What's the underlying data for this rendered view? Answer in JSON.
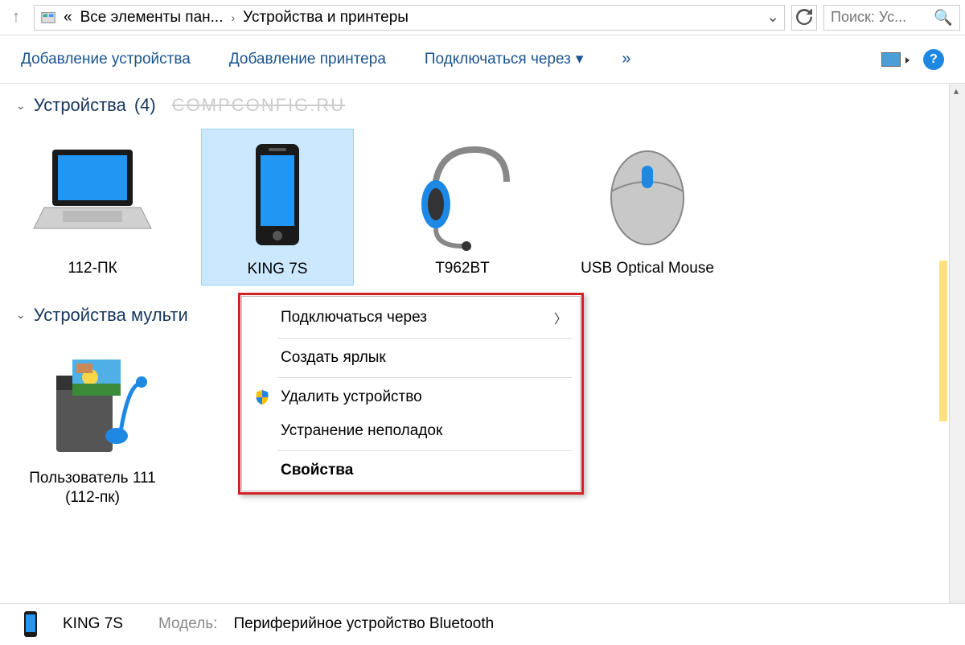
{
  "breadcrumb": {
    "prefix": "«",
    "item1": "Все элементы пан...",
    "sep": "›",
    "item2": "Устройства и принтеры"
  },
  "search": {
    "placeholder": "Поиск: Ус..."
  },
  "toolbar": {
    "add_device": "Добавление устройства",
    "add_printer": "Добавление принтера",
    "connect_via": "Подключаться через",
    "more": "»"
  },
  "sections": {
    "devices": {
      "title": "Устройства",
      "count": "(4)"
    },
    "multimedia": {
      "title": "Устройства мульти"
    }
  },
  "watermark": "COMPCONFIG.RU",
  "devices": [
    {
      "name": "112-ПК",
      "icon": "laptop"
    },
    {
      "name": "KING 7S",
      "icon": "phone",
      "selected": true
    },
    {
      "name": "T962BT",
      "icon": "headset"
    },
    {
      "name": "USB Optical Mouse",
      "icon": "mouse"
    }
  ],
  "multimedia_devices": [
    {
      "name": "Пользователь 111 (112-пк)",
      "icon": "media"
    }
  ],
  "context_menu": {
    "connect": "Подключаться через",
    "shortcut": "Создать ярлык",
    "remove": "Удалить устройство",
    "troubleshoot": "Устранение неполадок",
    "properties": "Свойства"
  },
  "details": {
    "name": "KING 7S",
    "model_label": "Модель:",
    "model_value": "Периферийное устройство Bluetooth"
  }
}
